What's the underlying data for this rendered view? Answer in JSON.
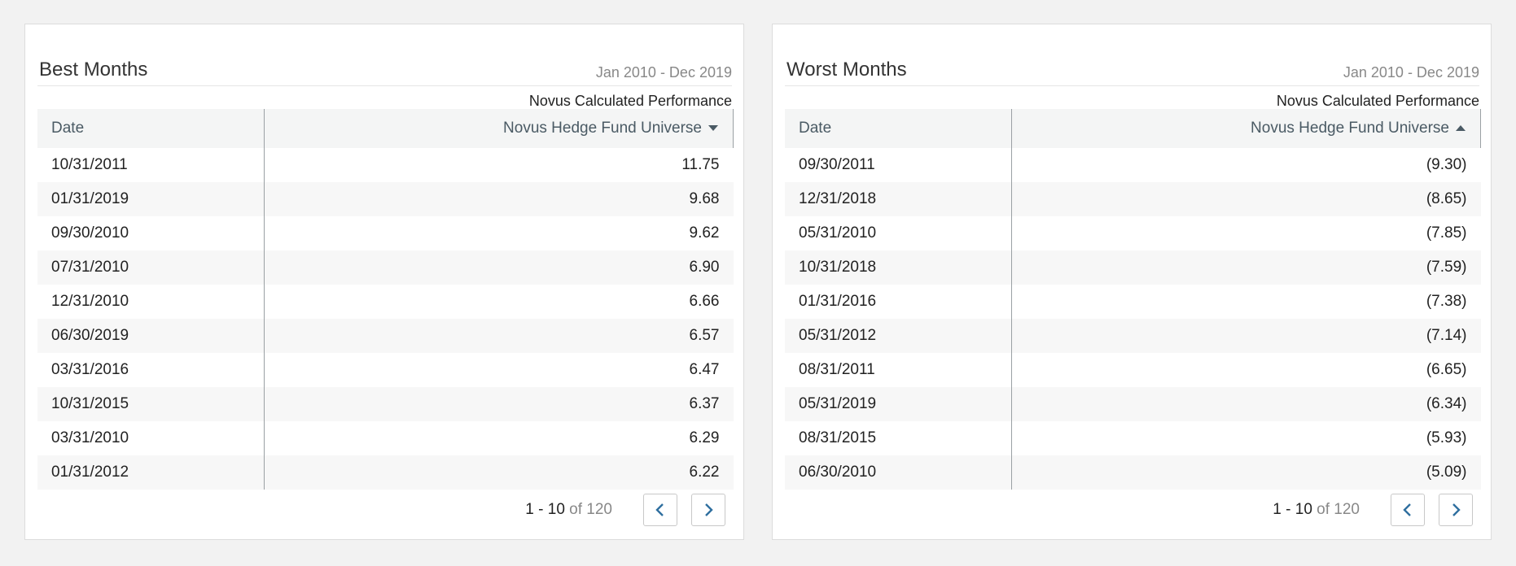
{
  "best": {
    "title": "Best Months",
    "range": "Jan 2010 - Dec 2019",
    "perf_label": "Novus Calculated Performance",
    "columns": {
      "date": "Date",
      "value": "Novus Hedge Fund Universe"
    },
    "sort": "descending",
    "rows": [
      {
        "date": "10/31/2011",
        "value": "11.75"
      },
      {
        "date": "01/31/2019",
        "value": "9.68"
      },
      {
        "date": "09/30/2010",
        "value": "9.62"
      },
      {
        "date": "07/31/2010",
        "value": "6.90"
      },
      {
        "date": "12/31/2010",
        "value": "6.66"
      },
      {
        "date": "06/30/2019",
        "value": "6.57"
      },
      {
        "date": "03/31/2016",
        "value": "6.47"
      },
      {
        "date": "10/31/2015",
        "value": "6.37"
      },
      {
        "date": "03/31/2010",
        "value": "6.29"
      },
      {
        "date": "01/31/2012",
        "value": "6.22"
      }
    ],
    "pager": {
      "range": "1 - 10",
      "of_label": "of 120"
    }
  },
  "worst": {
    "title": "Worst Months",
    "range": "Jan 2010 - Dec 2019",
    "perf_label": "Novus Calculated Performance",
    "columns": {
      "date": "Date",
      "value": "Novus Hedge Fund Universe"
    },
    "sort": "ascending",
    "rows": [
      {
        "date": "09/30/2011",
        "value": "(9.30)"
      },
      {
        "date": "12/31/2018",
        "value": "(8.65)"
      },
      {
        "date": "05/31/2010",
        "value": "(7.85)"
      },
      {
        "date": "10/31/2018",
        "value": "(7.59)"
      },
      {
        "date": "01/31/2016",
        "value": "(7.38)"
      },
      {
        "date": "05/31/2012",
        "value": "(7.14)"
      },
      {
        "date": "08/31/2011",
        "value": "(6.65)"
      },
      {
        "date": "05/31/2019",
        "value": "(6.34)"
      },
      {
        "date": "08/31/2015",
        "value": "(5.93)"
      },
      {
        "date": "06/30/2010",
        "value": "(5.09)"
      }
    ],
    "pager": {
      "range": "1 - 10",
      "of_label": "of 120"
    }
  },
  "icons": {
    "prev": "chevron-left-icon",
    "next": "chevron-right-icon",
    "sort_desc": "caret-down-icon",
    "sort_asc": "caret-up-icon"
  },
  "colors": {
    "accent": "#2f6f9f",
    "header_bg": "#f4f5f5",
    "page_bg": "#f2f2f2"
  }
}
